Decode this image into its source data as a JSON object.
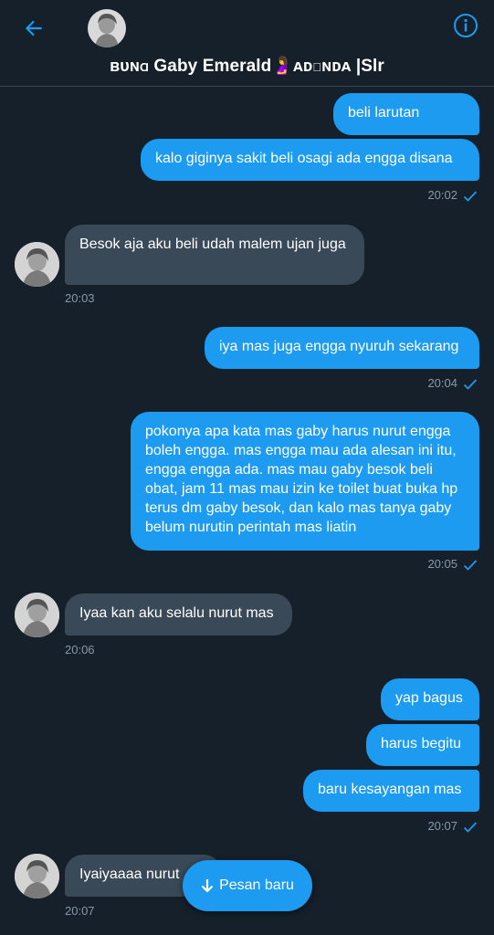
{
  "header": {
    "title_prefix": "ʙᴜɴɑ",
    "title_name": " Gaby Emerald",
    "title_emoji": "🤰",
    "title_suffix_sc": "ᴀᴅɪɴᴅᴀ",
    "title_tail": " |Slr"
  },
  "colors": {
    "accent": "#1d9bf0",
    "background": "#15202b",
    "received_bubble": "#3a4957",
    "timestamp": "#8899a6"
  },
  "icons": {
    "back": "back-arrow-icon",
    "info": "info-icon",
    "read": "checkmark-icon",
    "new_message": "arrow-down-icon"
  },
  "messages": [
    {
      "dir": "sent",
      "text": "beli larutan"
    },
    {
      "dir": "sent",
      "text": "kalo giginya sakit beli osagi ada engga disana",
      "time": "20:02"
    },
    {
      "dir": "recv",
      "text": "Besok aja aku beli udah malem ujan juga",
      "time": "20:03"
    },
    {
      "dir": "sent",
      "text": "iya mas juga engga nyuruh sekarang",
      "time": "20:04"
    },
    {
      "dir": "sent",
      "text": "pokonya apa kata mas gaby harus nurut engga boleh engga. mas engga mau ada alesan ini itu, engga engga ada. mas mau gaby besok beli obat, jam 11 mas mau izin ke toilet buat buka hp terus dm gaby besok, dan kalo mas tanya gaby belum nurutin perintah mas liatin",
      "time": "20:05"
    },
    {
      "dir": "recv",
      "text": "Iyaa kan aku selalu nurut mas",
      "time": "20:06"
    },
    {
      "dir": "sent",
      "text": "yap bagus"
    },
    {
      "dir": "sent",
      "text": "harus begitu"
    },
    {
      "dir": "sent",
      "text": "baru kesayangan mas",
      "time": "20:07"
    },
    {
      "dir": "recv",
      "text": "Iyaiyaaaa nurut",
      "time": "20:07"
    }
  ],
  "new_message_button": {
    "label": "Pesan baru"
  }
}
